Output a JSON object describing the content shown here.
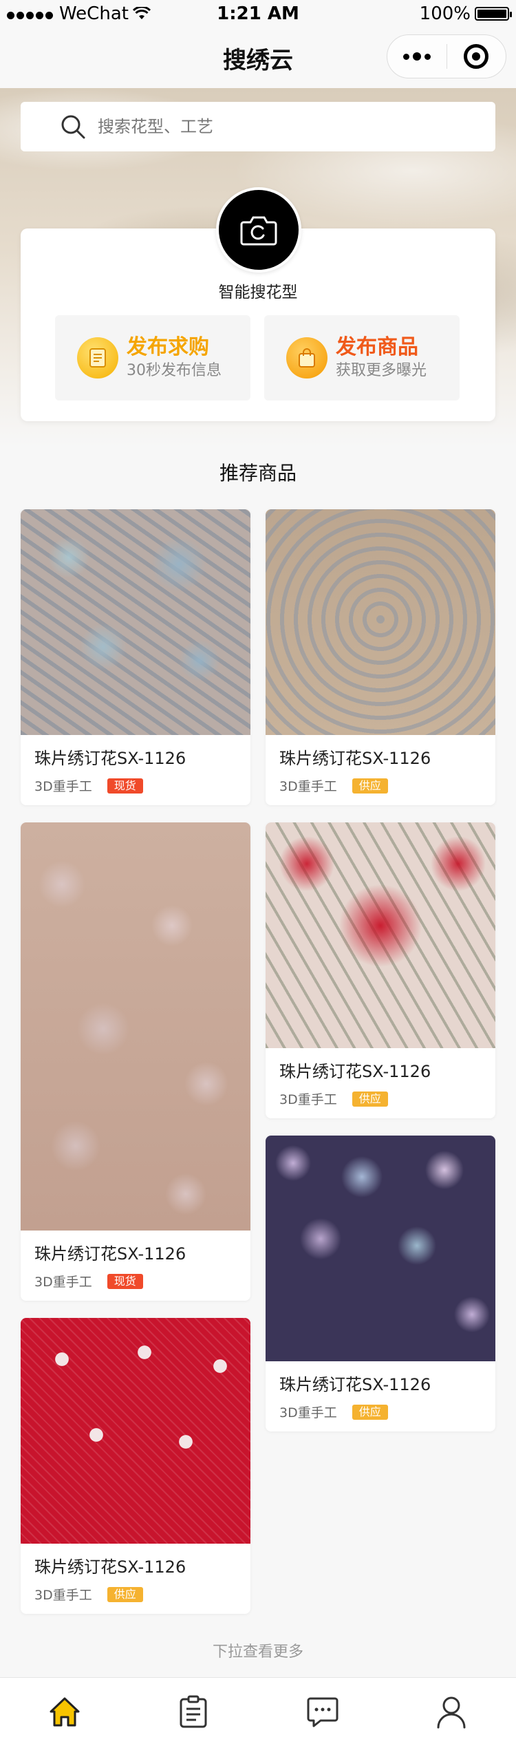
{
  "status_bar": {
    "carrier": "WeChat",
    "time": "1:21 AM",
    "battery": "100%"
  },
  "nav": {
    "title": "搜绣云"
  },
  "search": {
    "placeholder": "搜索花型、工艺"
  },
  "smart_search": {
    "label": "智能搜花型"
  },
  "actions": [
    {
      "title": "发布求购",
      "subtitle": "30秒发布信息"
    },
    {
      "title": "发布商品",
      "subtitle": "获取更多曝光"
    }
  ],
  "section": {
    "title": "推荐商品"
  },
  "products": [
    {
      "name": "珠片绣订花SX-1126",
      "spec": "3D重手工",
      "tag": "现货"
    },
    {
      "name": "珠片绣订花SX-1126",
      "spec": "3D重手工",
      "tag": "供应"
    },
    {
      "name": "珠片绣订花SX-1126",
      "spec": "3D重手工",
      "tag": "现货"
    },
    {
      "name": "珠片绣订花SX-1126",
      "spec": "3D重手工",
      "tag": "供应"
    },
    {
      "name": "珠片绣订花SX-1126",
      "spec": "3D重手工",
      "tag": "供应"
    },
    {
      "name": "珠片绣订花SX-1126",
      "spec": "3D重手工",
      "tag": "供应"
    }
  ],
  "load_more": "下拉查看更多",
  "tabs": [
    {
      "icon": "home-icon",
      "active": true
    },
    {
      "icon": "clipboard-icon",
      "active": false
    },
    {
      "icon": "message-icon",
      "active": false
    },
    {
      "icon": "user-icon",
      "active": false
    }
  ],
  "colors": {
    "accent_yellow": "#f5a500",
    "accent_red": "#f05a1a",
    "tag_red": "#f04a2a",
    "tag_yellow": "#f5b230"
  }
}
